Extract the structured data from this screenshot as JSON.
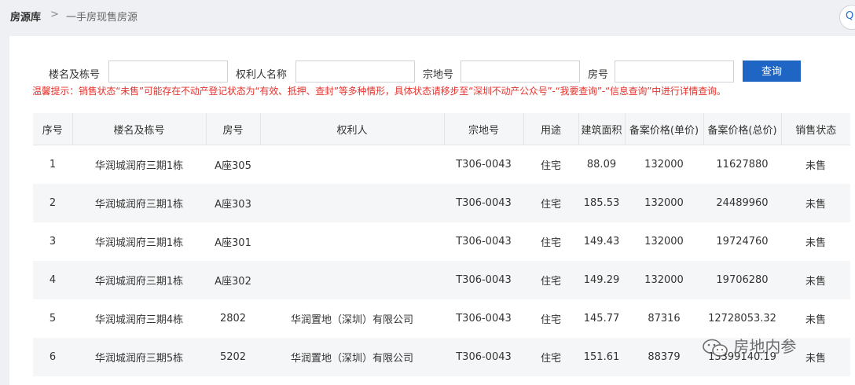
{
  "breadcrumb": {
    "root": "房源库",
    "separator": ">",
    "current": "一手房现售房源"
  },
  "corner_button": {
    "icon": "circle-button",
    "glyph": "Q"
  },
  "search": {
    "building_label": "楼名及栋号",
    "building_value": "",
    "owner_label": "权利人名称",
    "owner_value": "",
    "parcel_label": "宗地号",
    "parcel_value": "",
    "room_label": "房号",
    "room_value": "",
    "query_button": "查询"
  },
  "tip": "温馨提示：销售状态“未售”可能存在不动产登记状态为“有效、抵押、查封”等多种情形，具体状态请移步至“深圳不动产公众号”-“我要查询”-“信息查询”中进行详情查询。",
  "table": {
    "headers": [
      "序号",
      "楼名及栋号",
      "房号",
      "权利人",
      "宗地号",
      "用途",
      "建筑面积",
      "备案价格(单价)",
      "备案价格(总价)",
      "销售状态"
    ],
    "rows": [
      [
        "1",
        "华润城润府三期1栋",
        "A座305",
        "",
        "T306-0043",
        "住宅",
        "88.09",
        "132000",
        "11627880",
        "未售"
      ],
      [
        "2",
        "华润城润府三期1栋",
        "A座303",
        "",
        "T306-0043",
        "住宅",
        "185.53",
        "132000",
        "24489960",
        "未售"
      ],
      [
        "3",
        "华润城润府三期1栋",
        "A座301",
        "",
        "T306-0043",
        "住宅",
        "149.43",
        "132000",
        "19724760",
        "未售"
      ],
      [
        "4",
        "华润城润府三期1栋",
        "A座302",
        "",
        "T306-0043",
        "住宅",
        "149.29",
        "132000",
        "19706280",
        "未售"
      ],
      [
        "5",
        "华润城润府三期4栋",
        "2802",
        "华润置地（深圳）有限公司",
        "T306-0043",
        "住宅",
        "145.77",
        "87316",
        "12728053.32",
        "未售"
      ],
      [
        "6",
        "华润城润府三期5栋",
        "5202",
        "华润置地（深圳）有限公司",
        "T306-0043",
        "住宅",
        "151.61",
        "88379",
        "13399140.19",
        "未售"
      ]
    ]
  },
  "watermark": {
    "text": "房地内参",
    "icon": "wechat-icon"
  },
  "colors": {
    "accent": "#1f66c4",
    "tip": "#e5322d",
    "stripe": "#f5f6f7"
  }
}
